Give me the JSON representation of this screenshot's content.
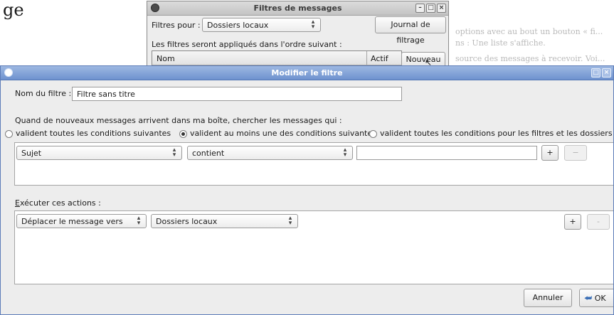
{
  "background": {
    "big_text": "ge",
    "line1": "options avec au bout un bouton « fi...",
    "line2": "ns : Une liste s'affiche.",
    "line3": "source des messages à recevoir. Voi..."
  },
  "filters_window": {
    "title": "Filtres de messages",
    "filters_for_label": "Filtres pour :",
    "filters_for_value": "Dossiers locaux",
    "journal_button": "Journal de filtrage",
    "order_text": "Les filtres seront appliqués dans l'ordre suivant :",
    "columns": [
      "Nom",
      "Actif"
    ],
    "new_button": "Nouveau"
  },
  "edit_filter": {
    "title": "Modifier le filtre",
    "name_label": "Nom du filtre :",
    "name_value": "Filtre sans titre",
    "when_text": "Quand de nouveaux messages arrivent dans ma boîte, chercher les messages qui :",
    "match_options": [
      {
        "label": "valident toutes les conditions suivantes",
        "selected": false
      },
      {
        "label": "valident au moins une des conditions suivantes",
        "selected": true
      },
      {
        "label": "valident toutes les conditions pour les filtres et les dossiers virtuels",
        "selected": false
      }
    ],
    "condition": {
      "field": "Sujet",
      "operator": "contient",
      "value": "",
      "add": "+",
      "remove": "−"
    },
    "actions_label": "Exécuter ces actions :",
    "action": {
      "type": "Déplacer le message vers",
      "target": "Dossiers locaux",
      "add": "+",
      "remove": "-"
    },
    "cancel_button": "Annuler",
    "ok_button": "OK"
  }
}
